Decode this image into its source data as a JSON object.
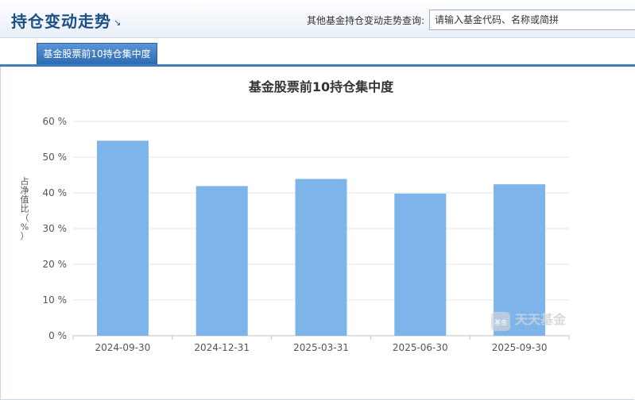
{
  "header": {
    "title": "持仓变动走势",
    "title_arrow": "↘",
    "search_label": "其他基金持仓变动走势查询:",
    "search_placeholder": "请输入基金代码、名称或简拼"
  },
  "tabs": [
    {
      "label": "基金股票前10持仓集中度",
      "active": true
    }
  ],
  "watermark": {
    "brand": "天天基金",
    "badge": "基金"
  },
  "colors": {
    "bar": "#7db4ea",
    "title": "#1c4f84",
    "accent": "#3d7cc1",
    "grid": "#e6e6e6"
  },
  "chart_data": {
    "type": "bar",
    "title": "基金股票前10持仓集中度",
    "ylabel": "占净值比（%）",
    "categories": [
      "2024-09-30",
      "2024-12-31",
      "2025-03-31",
      "2025-06-30",
      "2025-09-30"
    ],
    "values": [
      54.6,
      41.9,
      43.9,
      39.8,
      42.4
    ],
    "ylim": [
      0,
      60
    ],
    "yticks": [
      0,
      10,
      20,
      30,
      40,
      50,
      60
    ],
    "ytick_suffix": " %",
    "grid": true,
    "legend": "none"
  }
}
